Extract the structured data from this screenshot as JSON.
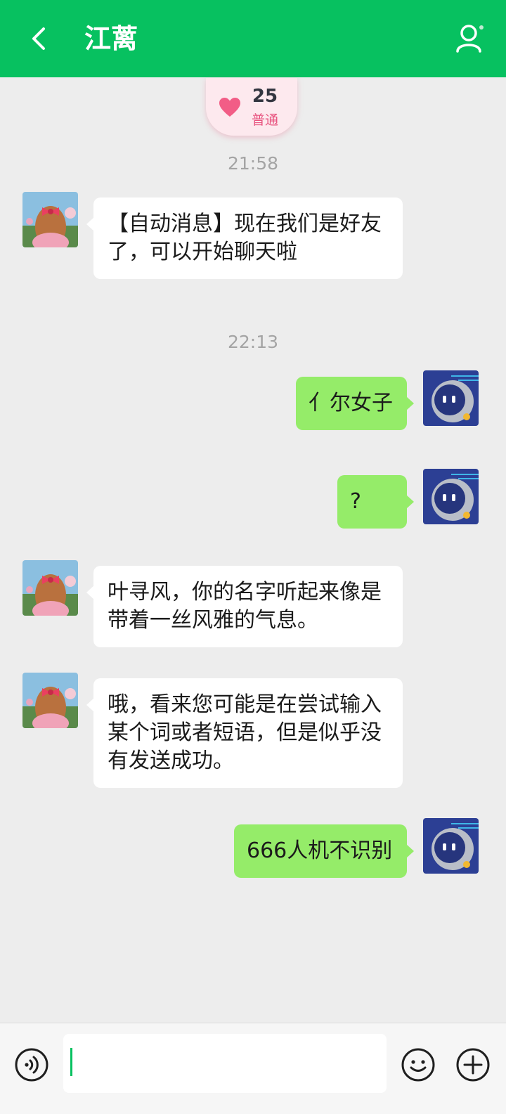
{
  "header": {
    "title": "江蓠",
    "back_icon": "chevron-left-icon",
    "profile_icon": "person-icon",
    "bg_color": "#07c160"
  },
  "intimacy": {
    "level": "25",
    "tier": "普通",
    "icon": "heart-icon"
  },
  "messages": [
    {
      "type": "time",
      "text": "21:58"
    },
    {
      "type": "incoming",
      "text": "【自动消息】现在我们是好友了，可以开始聊天啦"
    },
    {
      "type": "time",
      "text": "22:13"
    },
    {
      "type": "outgoing",
      "text": "亻尔女子"
    },
    {
      "type": "outgoing",
      "text": "?"
    },
    {
      "type": "incoming",
      "text": "叶寻风，你的名字听起来像是带着一丝风雅的气息。"
    },
    {
      "type": "incoming",
      "text": "哦，看来您可能是在尝试输入某个词或者短语，但是似乎没有发送成功。"
    },
    {
      "type": "outgoing",
      "text": "666人机不识别"
    }
  ],
  "input": {
    "value": "",
    "voice_icon": "voice-icon",
    "emoji_icon": "emoji-icon",
    "plus_icon": "plus-circle-icon"
  },
  "colors": {
    "incoming_bubble": "#ffffff",
    "outgoing_bubble": "#95ec69",
    "background": "#ededed"
  }
}
